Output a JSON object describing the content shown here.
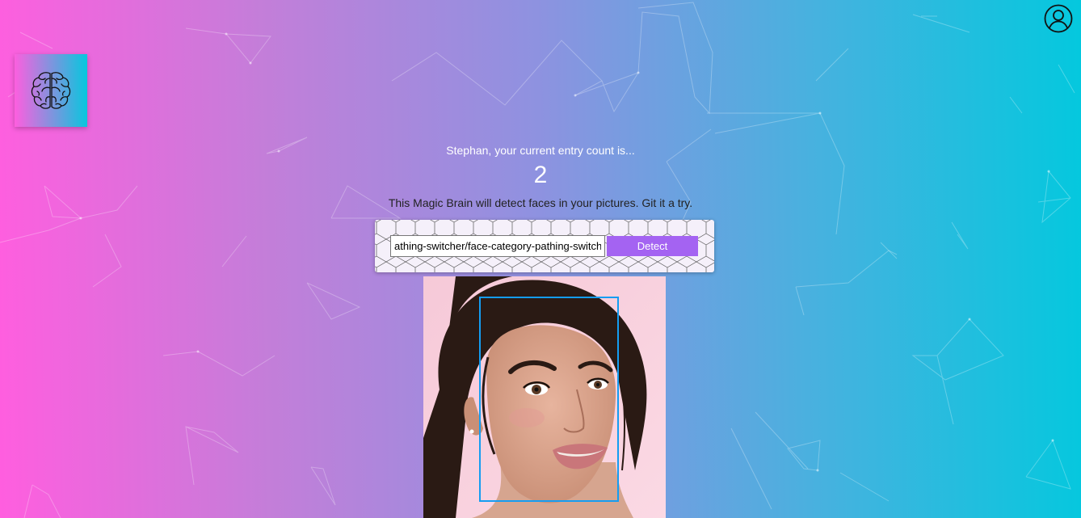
{
  "navigation": {
    "profile_icon": "user-circle-icon"
  },
  "logo": {
    "icon": "brain-icon"
  },
  "rank": {
    "message": "Stephan, your current entry count is...",
    "count": "2"
  },
  "tagline": "This Magic Brain will detect faces in your pictures. Git it a try.",
  "image_form": {
    "input_value": "athing-switcher/face-category-pathing-switcher",
    "detect_label": "Detect"
  },
  "colors": {
    "gradient_start": "#ff5edf",
    "gradient_end": "#04c8de",
    "button": "#a463f2",
    "face_box": "#149df2"
  }
}
